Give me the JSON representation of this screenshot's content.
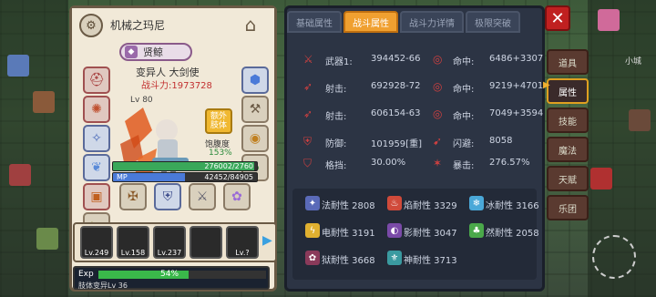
{
  "character": {
    "name": "机械之玛尼",
    "title": "贤鲸",
    "job": "变异人 大剑使",
    "power_label": "战斗力:",
    "power_value": "1973728",
    "level_label": "Lv 80",
    "extra_button": "额外肢体",
    "satiety_label": "饱腹度",
    "satiety_value": "153%",
    "hp_current": "276002",
    "hp_max": "2760",
    "mp_label": "MP",
    "mp_value": "42452/84905",
    "hp_fraction": 0.98,
    "mp_fraction": 0.5
  },
  "party": [
    {
      "level": "Lv.249",
      "selected": true
    },
    {
      "level": "Lv.158",
      "selected": false
    },
    {
      "level": "Lv.237",
      "selected": false
    },
    {
      "level": "",
      "selected": false
    },
    {
      "level": "Lv.?",
      "selected": false
    }
  ],
  "exp": {
    "label": "Exp",
    "percent": "54%",
    "fraction": 0.54,
    "sub": "肢体变异Lv 36"
  },
  "tabs": [
    "基础属性",
    "战斗属性",
    "战斗力详情",
    "极限突破"
  ],
  "active_tab": 1,
  "stats": [
    {
      "label": "武器1:",
      "value": "394452-66",
      "label2": "命中:",
      "value2": "6486+3307"
    },
    {
      "label": "射击:",
      "value": "692928-72",
      "label2": "命中:",
      "value2": "9219+4701"
    },
    {
      "label": "射击:",
      "value": "606154-63",
      "label2": "命中:",
      "value2": "7049+3594"
    },
    {
      "label": "防御:",
      "value": "101959[重]",
      "label2": "闪避:",
      "value2": "8058"
    },
    {
      "label": "格挡:",
      "value": "30.00%",
      "label2": "暴击:",
      "value2": "276.57%"
    }
  ],
  "resistances": [
    {
      "text": "法耐性 2808",
      "color": "#5a6ab8",
      "icon": "✦"
    },
    {
      "text": "焰耐性 3329",
      "color": "#d04a3a",
      "icon": "♨"
    },
    {
      "text": "冰耐性 3166",
      "color": "#4aa8d8",
      "icon": "❄"
    },
    {
      "text": "电耐性 3191",
      "color": "#e0b030",
      "icon": "ϟ"
    },
    {
      "text": "影耐性 3047",
      "color": "#7a4aa8",
      "icon": "◐"
    },
    {
      "text": "然耐性 2058",
      "color": "#4aa84a",
      "icon": "♣"
    },
    {
      "text": "狱耐性 3668",
      "color": "#8a3a5a",
      "icon": "✿"
    },
    {
      "text": "神耐性 3713",
      "color": "#3a9aa0",
      "icon": "⚜"
    }
  ],
  "side_menu": [
    "道具",
    "属性",
    "技能",
    "魔法",
    "天赋",
    "乐团"
  ],
  "side_active": 1,
  "minimap_label": "小城"
}
